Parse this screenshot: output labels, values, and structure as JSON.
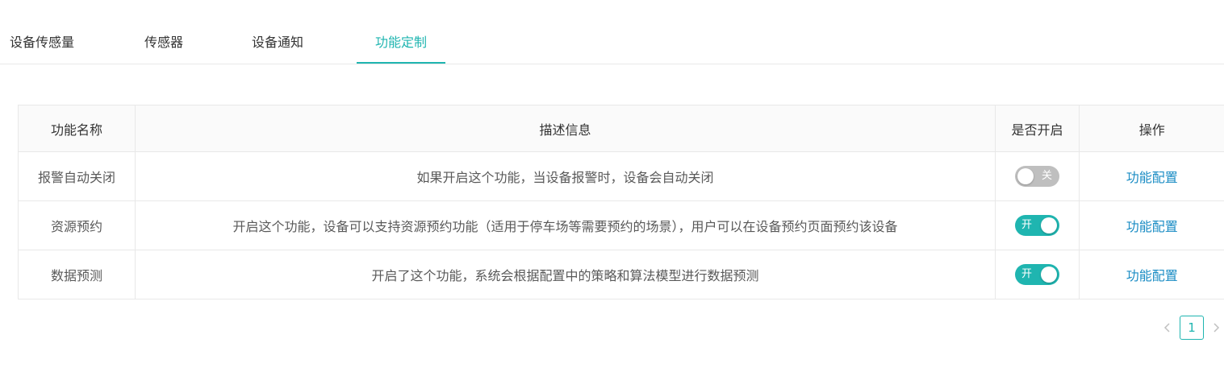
{
  "tabs": [
    {
      "label": "设备传感量",
      "active": false
    },
    {
      "label": "传感器",
      "active": false
    },
    {
      "label": "设备通知",
      "active": false
    },
    {
      "label": "功能定制",
      "active": true
    }
  ],
  "table": {
    "headers": [
      "功能名称",
      "描述信息",
      "是否开启",
      "操作"
    ],
    "rows": [
      {
        "name": "报警自动关闭",
        "description": "如果开启这个功能，当设备报警时，设备会自动关闭",
        "enabled": false,
        "switch_text": "关",
        "action": "功能配置"
      },
      {
        "name": "资源预约",
        "description": "开启这个功能，设备可以支持资源预约功能（适用于停车场等需要预约的场景），用户可以在设备预约页面预约该设备",
        "enabled": true,
        "switch_text": "开",
        "action": "功能配置"
      },
      {
        "name": "数据预测",
        "description": "开启了这个功能，系统会根据配置中的策略和算法模型进行数据预测",
        "enabled": true,
        "switch_text": "开",
        "action": "功能配置"
      }
    ]
  },
  "pagination": {
    "current_page": "1",
    "prev_icon": "chevron-left-icon",
    "next_icon": "chevron-right-icon"
  },
  "colors": {
    "accent": "#1fb5b0",
    "link": "#1a8cc4",
    "switch_off": "#bfbfbf"
  }
}
